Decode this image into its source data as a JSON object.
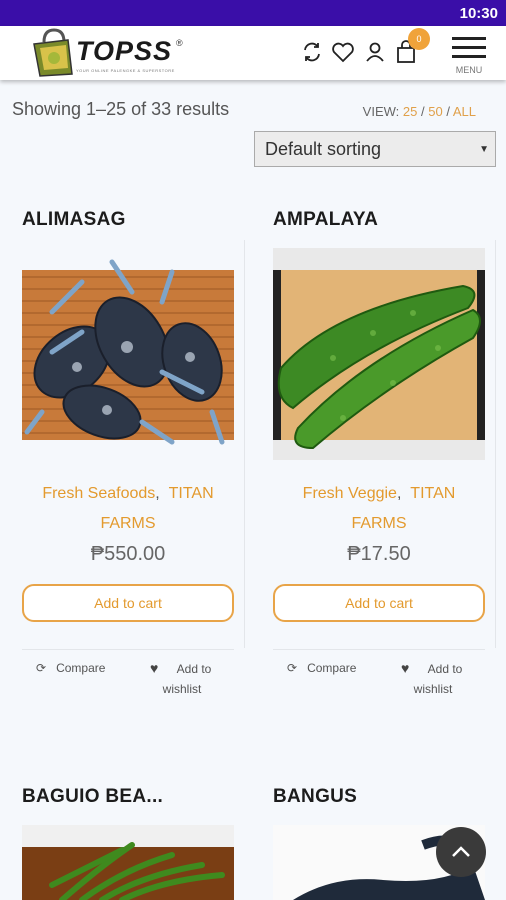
{
  "status_bar": {
    "time": "10:30"
  },
  "header": {
    "logo_text": "TOPSS",
    "logo_tagline": "YOUR ONLINE PALENGKE & SUPERSTORE",
    "logo_reg": "®",
    "cart_count": "0",
    "menu_label": "MENU",
    "icons": [
      "compare-icon",
      "heart-icon",
      "user-icon",
      "bag-icon",
      "hamburger-icon"
    ]
  },
  "listing": {
    "results_text": "Showing 1–25 of 33 results",
    "view_label": "VIEW:",
    "view_options": [
      "25",
      "50",
      "ALL"
    ],
    "view_sep": "/",
    "sort_selected": "Default sorting"
  },
  "products": [
    {
      "title": "ALIMASAG",
      "category": "Fresh Seafoods",
      "farm_line1": "TITAN",
      "farm_line2": "FARMS",
      "price": "₱550.00",
      "add_to_cart": "Add to cart",
      "compare": "Compare",
      "wishlist_line1": "Add to",
      "wishlist_line2": "wishlist"
    },
    {
      "title": "AMPALAYA",
      "category": "Fresh Veggie",
      "farm_line1": "TITAN",
      "farm_line2": "FARMS",
      "price": "₱17.50",
      "add_to_cart": "Add to cart",
      "compare": "Compare",
      "wishlist_line1": "Add to",
      "wishlist_line2": "wishlist"
    },
    {
      "title": "BAGUIO BEA..."
    },
    {
      "title": "BANGUS"
    }
  ],
  "colors": {
    "accent": "#e39a2e",
    "status_bar": "#3a0ea8",
    "badge": "#f0a33a"
  }
}
